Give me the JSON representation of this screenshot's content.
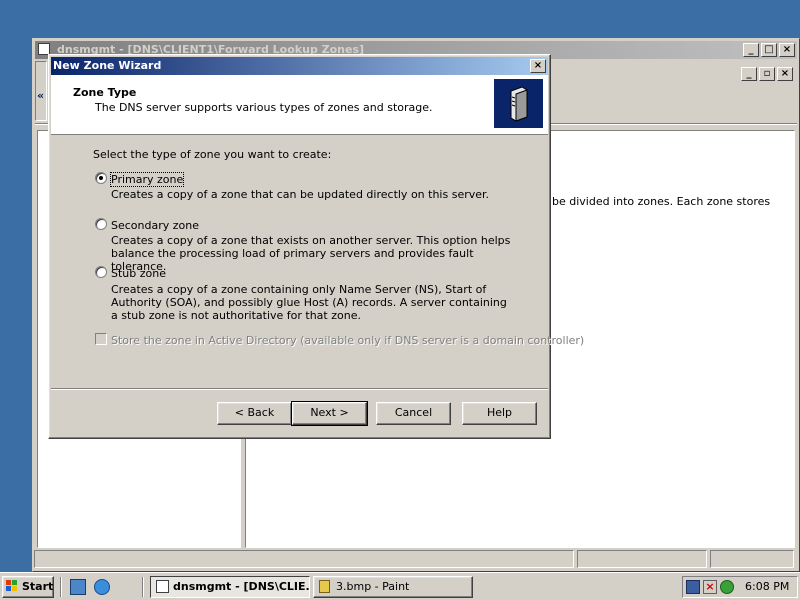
{
  "mmc": {
    "title": "dnsmgmt - [DNS\\CLIENT1\\Forward Lookup Zones]",
    "right_pane_text": "be divided into zones. Each zone stores"
  },
  "wizard": {
    "title": "New Zone Wizard",
    "header_title": "Zone Type",
    "header_subtitle": "The DNS server supports various types of zones and storage.",
    "prompt": "Select the type of zone you want to create:",
    "options": [
      {
        "label": "Primary zone",
        "checked": true,
        "description": "Creates a copy of a zone that can be updated directly on this server."
      },
      {
        "label": "Secondary zone",
        "checked": false,
        "description": "Creates a copy of a zone that exists on another server. This option helps balance the processing load of primary servers and provides fault tolerance."
      },
      {
        "label": "Stub zone",
        "checked": false,
        "description": "Creates a copy of a zone containing only Name Server (NS), Start of Authority (SOA), and possibly glue Host (A) records. A server containing a stub zone is not authoritative for that zone."
      }
    ],
    "ad_checkbox_label": "Store the zone in Active Directory (available only if DNS server is a domain controller)",
    "ad_checkbox_enabled": false,
    "buttons": {
      "back": "< Back",
      "next": "Next >",
      "cancel": "Cancel",
      "help": "Help"
    }
  },
  "taskbar": {
    "start": "Start",
    "tasks": [
      {
        "label": "dnsmgmt - [DNS\\CLIE...",
        "active": true
      },
      {
        "label": "3.bmp - Paint",
        "active": false
      }
    ],
    "clock": "6:08 PM"
  },
  "colors": {
    "desktop": "#3a6ea5",
    "active_title_start": "#0a246a",
    "active_title_end": "#a6caf0",
    "inactive_title_start": "#808080",
    "face": "#d4d0c8"
  }
}
